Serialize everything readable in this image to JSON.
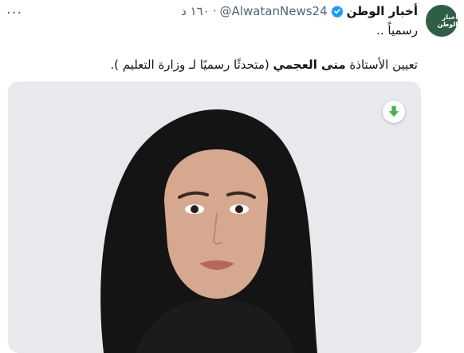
{
  "tweet": {
    "more_glyph": "···",
    "avatar_text": "أخبار الوطن",
    "display_name": "أخبار الوطن",
    "handle": "@AlwatanNews24",
    "separator": "·",
    "time": "١٦٠ د",
    "text_line1": "رسمياً ..",
    "text_line2_prefix": "تعيين الأستاذة ",
    "text_line2_bold": "منى العجمي",
    "text_line2_suffix": " (متحدثًا رسميًا لـ وزارة التعليم )."
  },
  "icons": {
    "verified": "verified-badge-icon",
    "download": "download-icon",
    "more": "more-options-icon"
  },
  "colors": {
    "verified_blue": "#1d9bf0",
    "avatar_bg": "#2f5e46",
    "download_green": "#4caf50",
    "secondary_text": "#536471"
  }
}
